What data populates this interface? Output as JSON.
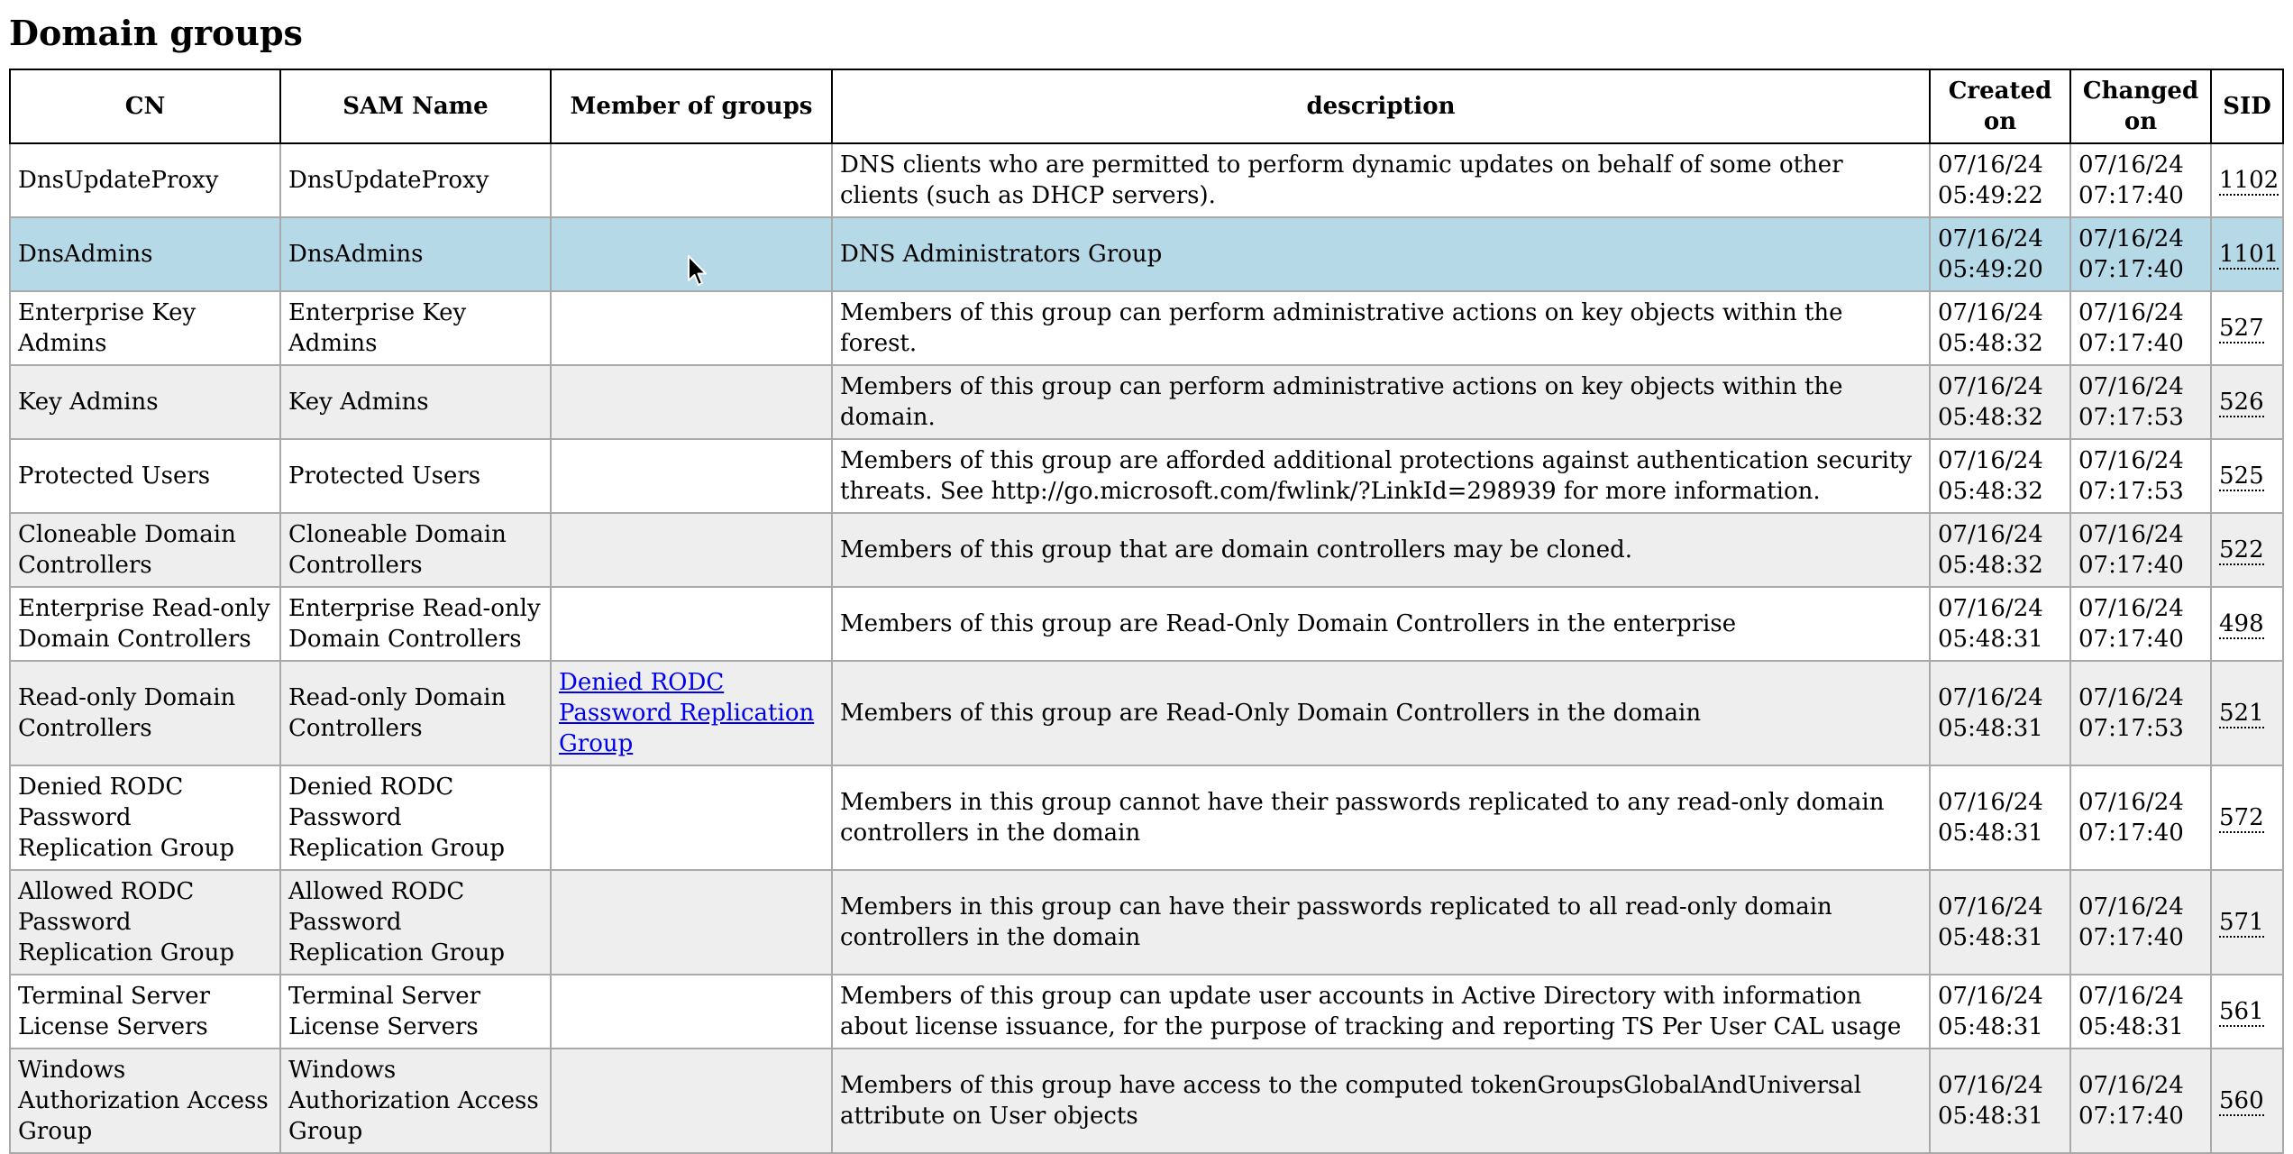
{
  "title": "Domain groups",
  "columns": [
    "CN",
    "SAM Name",
    "Member of groups",
    "description",
    "Created on",
    "Changed on",
    "SID"
  ],
  "rows": [
    {
      "cn": "DnsUpdateProxy",
      "sam": "DnsUpdateProxy",
      "member": "",
      "description": "DNS clients who are permitted to perform dynamic updates on behalf of some other clients (such as DHCP servers).",
      "created": "07/16/24 05:49:22",
      "changed": "07/16/24 07:17:40",
      "sid": "1102"
    },
    {
      "cn": "DnsAdmins",
      "sam": "DnsAdmins",
      "member": "",
      "description": "DNS Administrators Group",
      "created": "07/16/24 05:49:20",
      "changed": "07/16/24 07:17:40",
      "sid": "1101"
    },
    {
      "cn": "Enterprise Key Admins",
      "sam": "Enterprise Key Admins",
      "member": "",
      "description": "Members of this group can perform administrative actions on key objects within the forest.",
      "created": "07/16/24 05:48:32",
      "changed": "07/16/24 07:17:40",
      "sid": "527"
    },
    {
      "cn": "Key Admins",
      "sam": "Key Admins",
      "member": "",
      "description": "Members of this group can perform administrative actions on key objects within the domain.",
      "created": "07/16/24 05:48:32",
      "changed": "07/16/24 07:17:53",
      "sid": "526"
    },
    {
      "cn": "Protected Users",
      "sam": "Protected Users",
      "member": "",
      "description": "Members of this group are afforded additional protections against authentication security threats. See http://go.microsoft.com/fwlink/?LinkId=298939 for more information.",
      "created": "07/16/24 05:48:32",
      "changed": "07/16/24 07:17:53",
      "sid": "525"
    },
    {
      "cn": "Cloneable Domain Controllers",
      "sam": "Cloneable Domain Controllers",
      "member": "",
      "description": "Members of this group that are domain controllers may be cloned.",
      "created": "07/16/24 05:48:32",
      "changed": "07/16/24 07:17:40",
      "sid": "522"
    },
    {
      "cn": "Enterprise Read-only Domain Controllers",
      "sam": "Enterprise Read-only Domain Controllers",
      "member": "",
      "description": "Members of this group are Read-Only Domain Controllers in the enterprise",
      "created": "07/16/24 05:48:31",
      "changed": "07/16/24 07:17:40",
      "sid": "498"
    },
    {
      "cn": "Read-only Domain Controllers",
      "sam": "Read-only Domain Controllers",
      "member": "Denied RODC Password Replication Group",
      "description": "Members of this group are Read-Only Domain Controllers in the domain",
      "created": "07/16/24 05:48:31",
      "changed": "07/16/24 07:17:53",
      "sid": "521"
    },
    {
      "cn": "Denied RODC Password Replication Group",
      "sam": "Denied RODC Password Replication Group",
      "member": "",
      "description": "Members in this group cannot have their passwords replicated to any read-only domain controllers in the domain",
      "created": "07/16/24 05:48:31",
      "changed": "07/16/24 07:17:40",
      "sid": "572"
    },
    {
      "cn": "Allowed RODC Password Replication Group",
      "sam": "Allowed RODC Password Replication Group",
      "member": "",
      "description": "Members in this group can have their passwords replicated to all read-only domain controllers in the domain",
      "created": "07/16/24 05:48:31",
      "changed": "07/16/24 07:17:40",
      "sid": "571"
    },
    {
      "cn": "Terminal Server License Servers",
      "sam": "Terminal Server License Servers",
      "member": "",
      "description": "Members of this group can update user accounts in Active Directory with information about license issuance, for the purpose of tracking and reporting TS Per User CAL usage",
      "created": "07/16/24 05:48:31",
      "changed": "07/16/24 05:48:31",
      "sid": "561"
    },
    {
      "cn": "Windows Authorization Access Group",
      "sam": "Windows Authorization Access Group",
      "member": "",
      "description": "Members of this group have access to the computed tokenGroupsGlobalAndUniversal attribute on User objects",
      "created": "07/16/24 05:48:31",
      "changed": "07/16/24 07:17:40",
      "sid": "560"
    }
  ],
  "highlight_row": 1,
  "icons": {
    "cursor": "mouse-pointer-icon"
  }
}
